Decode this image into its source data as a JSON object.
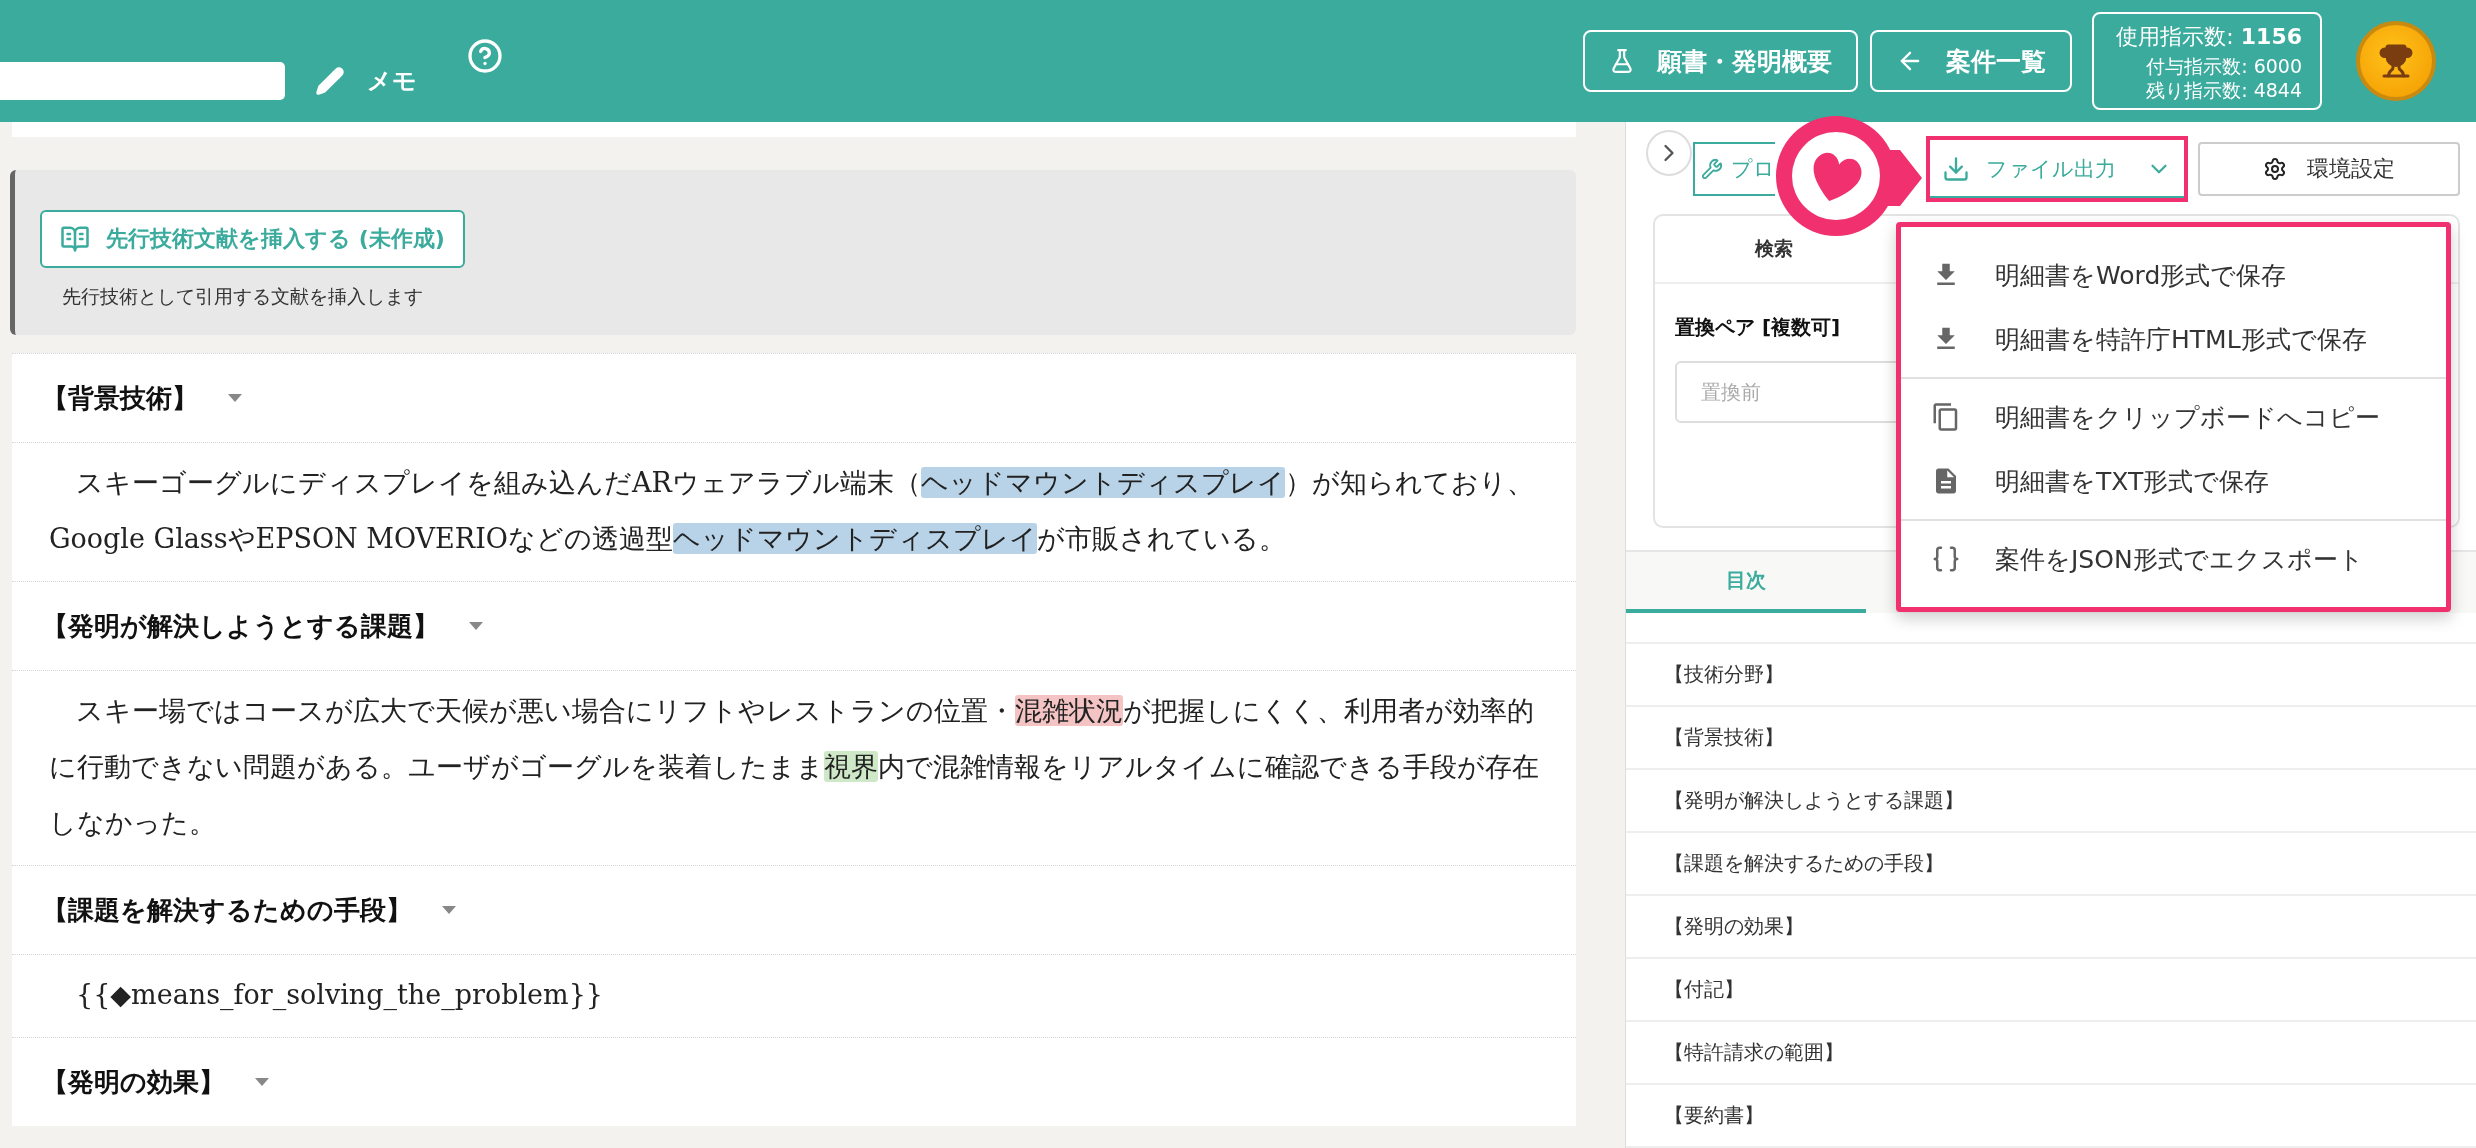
{
  "header": {
    "memo_button": "メモ",
    "overview_button": "願書・発明概要",
    "case_list_button": "案件一覧",
    "usage": {
      "used": "使用指示数: **1156**",
      "granted": "付与指示数: 6000",
      "remaining": "残り指示数: 4844"
    }
  },
  "prior_art": {
    "button": "先行技術文献を挿入する (未作成)",
    "caption": "先行技術として引用する文献を挿入します"
  },
  "document": {
    "sections": [
      {
        "heading": "【背景技術】",
        "paragraph": [
          {
            "text": "スキーゴーグルにディスプレイを組み込んだARウェアラブル端末（"
          },
          {
            "text": "ヘッドマウントディスプレイ",
            "color": "#b8d3e8"
          },
          {
            "text": "）が知られており、Google GlassやEPSON MOVERIOなどの透過型"
          },
          {
            "text": "ヘッドマウントディスプレイ",
            "color": "#b8d3e8"
          },
          {
            "text": "が市販されている。"
          }
        ]
      },
      {
        "heading": "【発明が解決しようとする課題】",
        "paragraph": [
          {
            "text": "スキー場ではコースが広大で天候が悪い場合にリフトやレストランの位置・"
          },
          {
            "text": "混雑状況",
            "color": "#f4c4c4"
          },
          {
            "text": "が把握しにくく、利用者が効率的に行動できない問題がある。ユーザがゴーグルを装着したまま"
          },
          {
            "text": "視界",
            "color": "#cfe8c8"
          },
          {
            "text": "内で混雑情報をリアルタイムに確認できる手段が存在しなかった。"
          }
        ]
      },
      {
        "heading": "【課題を解決するための手段】",
        "paragraph": [
          {
            "text": "{{◆means_for_solving_the_problem}}"
          }
        ]
      },
      {
        "heading": "【発明の効果】"
      }
    ]
  },
  "toolbar": {
    "tool_button": "プロ",
    "file_output_button": "ファイル出力",
    "settings_button": "環境設定"
  },
  "search_card": {
    "tab": "検索",
    "label": "置換ペア [複数可]",
    "input": {
      "placeholder": "置換前"
    }
  },
  "file_menu": {
    "groups": [
      {
        "items": [
          {
            "label": "明細書をWord形式で保存"
          },
          {
            "label": "明細書を特許庁HTML形式で保存"
          }
        ]
      },
      {
        "items": [
          {
            "label": "明細書をクリップボードへコピー"
          },
          {
            "label": "明細書をTXT形式で保存"
          }
        ]
      },
      {
        "items": [
          {
            "label": "案件をJSON形式でエクスポート"
          }
        ]
      }
    ]
  },
  "side_tabs": [
    {
      "label": "目次",
      "selected": true
    }
  ],
  "toc": [
    "【技術分野】",
    "【背景技術】",
    "【発明が解決しようとする課題】",
    "【課題を解決するための手段】",
    "【発明の効果】",
    "【付記】",
    "【特許請求の範囲】",
    "【要約書】"
  ]
}
